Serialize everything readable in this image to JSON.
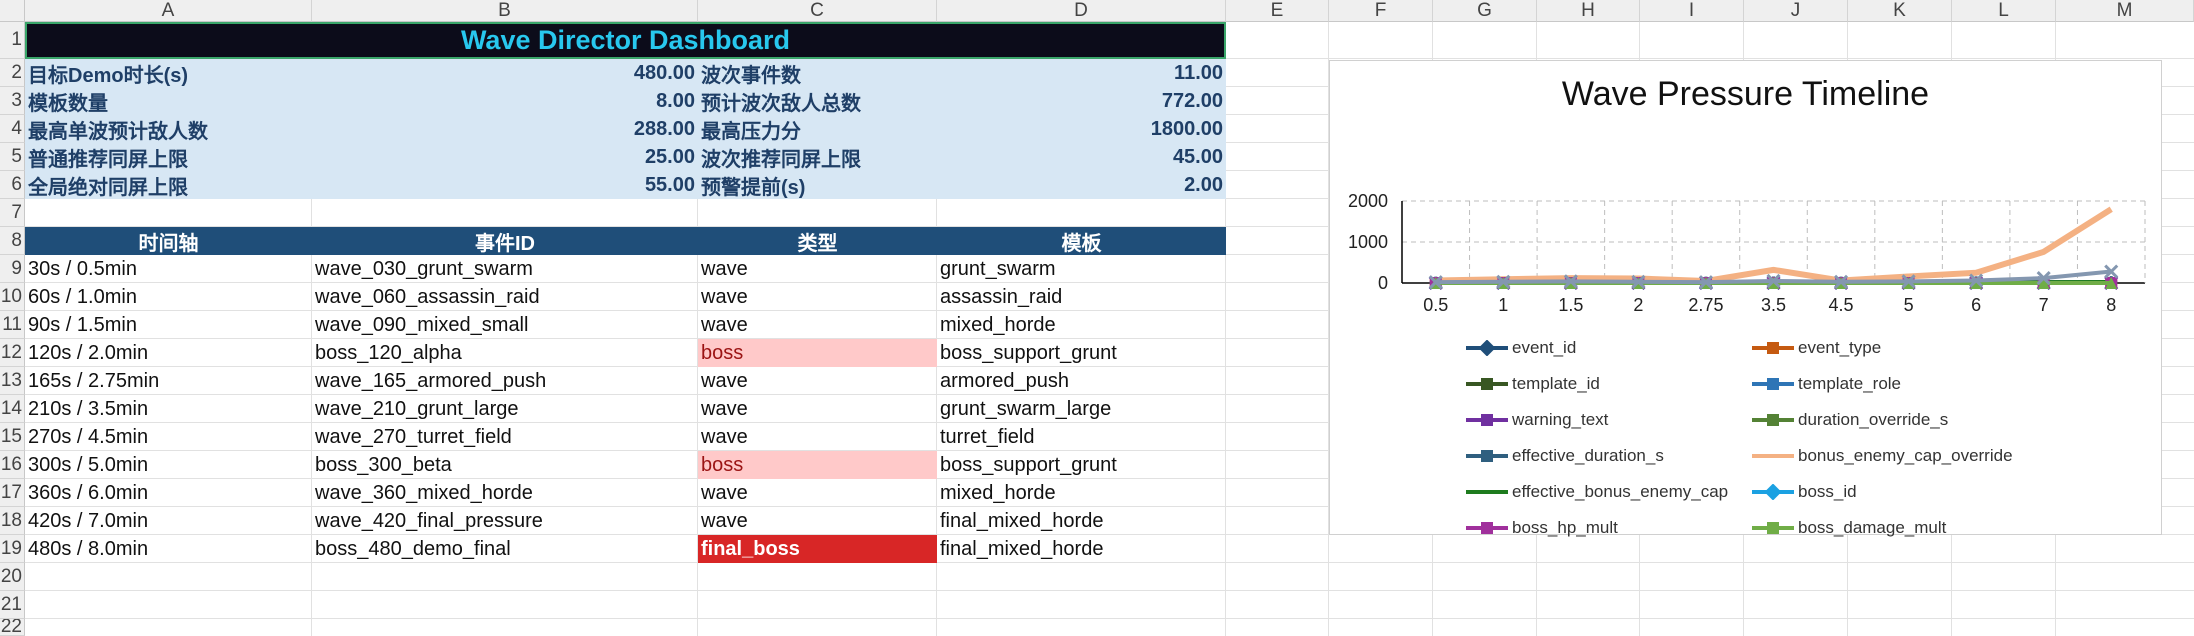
{
  "columns": [
    "A",
    "B",
    "C",
    "D",
    "E",
    "F",
    "G",
    "H",
    "I",
    "J",
    "K",
    "L",
    "M"
  ],
  "rows": [
    "1",
    "2",
    "3",
    "4",
    "5",
    "6",
    "7",
    "8",
    "9",
    "10",
    "11",
    "12",
    "13",
    "14",
    "15",
    "16",
    "17",
    "18",
    "19",
    "20",
    "21",
    "22"
  ],
  "title": "Wave Director Dashboard",
  "summary": [
    {
      "label_left": "目标Demo时长(s)",
      "value_left": "480.00",
      "label_right": "波次事件数",
      "value_right": "11.00"
    },
    {
      "label_left": "模板数量",
      "value_left": "8.00",
      "label_right": "预计波次敌人总数",
      "value_right": "772.00"
    },
    {
      "label_left": "最高单波预计敌人数",
      "value_left": "288.00",
      "label_right": "最高压力分",
      "value_right": "1800.00"
    },
    {
      "label_left": "普通推荐同屏上限",
      "value_left": "25.00",
      "label_right": "波次推荐同屏上限",
      "value_right": "45.00"
    },
    {
      "label_left": "全局绝对同屏上限",
      "value_left": "55.00",
      "label_right": "预警提前(s)",
      "value_right": "2.00"
    }
  ],
  "table": {
    "headers": [
      "时间轴",
      "事件ID",
      "类型",
      "模板"
    ],
    "rows": [
      [
        "30s / 0.5min",
        "wave_030_grunt_swarm",
        "wave",
        "grunt_swarm"
      ],
      [
        "60s / 1.0min",
        "wave_060_assassin_raid",
        "wave",
        "assassin_raid"
      ],
      [
        "90s / 1.5min",
        "wave_090_mixed_small",
        "wave",
        "mixed_horde"
      ],
      [
        "120s / 2.0min",
        "boss_120_alpha",
        "boss",
        "boss_support_grunt"
      ],
      [
        "165s / 2.75min",
        "wave_165_armored_push",
        "wave",
        "armored_push"
      ],
      [
        "210s / 3.5min",
        "wave_210_grunt_large",
        "wave",
        "grunt_swarm_large"
      ],
      [
        "270s / 4.5min",
        "wave_270_turret_field",
        "wave",
        "turret_field"
      ],
      [
        "300s / 5.0min",
        "boss_300_beta",
        "boss",
        "boss_support_grunt"
      ],
      [
        "360s / 6.0min",
        "wave_360_mixed_horde",
        "wave",
        "mixed_horde"
      ],
      [
        "420s / 7.0min",
        "wave_420_final_pressure",
        "wave",
        "final_mixed_horde"
      ],
      [
        "480s / 8.0min",
        "boss_480_demo_final",
        "final_boss",
        "final_mixed_horde"
      ]
    ]
  },
  "chart_data": {
    "type": "line",
    "title": "Wave Pressure Timeline",
    "categories": [
      "0.5",
      "1",
      "1.5",
      "2",
      "2.75",
      "3.5",
      "4.5",
      "5",
      "6",
      "7",
      "8"
    ],
    "ylim": [
      0,
      2000
    ],
    "yticks": [
      "0",
      "1000",
      "2000"
    ],
    "grid": true,
    "legend_position": "bottom",
    "series": [
      {
        "name": "event_id",
        "color": "#1f4e79",
        "marker": "diamond",
        "values": [
          0,
          0,
          0,
          0,
          0,
          0,
          0,
          0,
          0,
          0,
          0
        ]
      },
      {
        "name": "event_type",
        "color": "#c55a11",
        "marker": "square",
        "values": [
          0,
          0,
          0,
          0,
          0,
          0,
          0,
          0,
          0,
          0,
          0
        ]
      },
      {
        "name": "template_id",
        "color": "#385723",
        "marker": "triangle",
        "values": [
          0,
          0,
          0,
          0,
          0,
          0,
          0,
          0,
          0,
          0,
          0
        ]
      },
      {
        "name": "template_role",
        "color": "#2e75b6",
        "marker": "x",
        "values": [
          0,
          0,
          0,
          0,
          0,
          0,
          0,
          0,
          0,
          0,
          0
        ]
      },
      {
        "name": "warning_text",
        "color": "#7030a0",
        "marker": "star",
        "values": [
          0,
          0,
          0,
          0,
          0,
          0,
          0,
          0,
          0,
          0,
          0
        ]
      },
      {
        "name": "duration_override_s",
        "color": "#548235",
        "marker": "circle",
        "values": [
          0,
          0,
          0,
          0,
          0,
          0,
          0,
          0,
          0,
          0,
          0
        ]
      },
      {
        "name": "effective_duration_s",
        "color": "#2f5f7f",
        "marker": "plus",
        "values": [
          10,
          10,
          10,
          12,
          10,
          12,
          10,
          15,
          15,
          20,
          20
        ]
      },
      {
        "name": "bonus_enemy_cap_override",
        "color": "#f4b183",
        "marker": "none",
        "values": [
          60,
          90,
          120,
          110,
          50,
          320,
          60,
          160,
          250,
          760,
          1800
        ]
      },
      {
        "name": "effective_bonus_enemy_cap",
        "color": "#1e7b1e",
        "marker": "none",
        "values": [
          5,
          5,
          8,
          10,
          5,
          10,
          8,
          10,
          15,
          20,
          25
        ]
      },
      {
        "name": "boss_id",
        "color": "#1ba1e2",
        "marker": "diamond",
        "values": [
          0,
          0,
          0,
          0,
          0,
          0,
          0,
          0,
          0,
          0,
          0
        ]
      },
      {
        "name": "boss_hp_mult",
        "color": "#a0309c",
        "marker": "square",
        "values": [
          0,
          0,
          0,
          0,
          0,
          0,
          0,
          0,
          0,
          0,
          0
        ]
      },
      {
        "name": "boss_damage_mult",
        "color": "#70ad47",
        "marker": "triangle",
        "values": [
          0,
          0,
          0,
          0,
          0,
          0,
          0,
          0,
          0,
          0,
          0
        ]
      },
      {
        "name": "",
        "color": "#8497b0",
        "marker": "x",
        "values": [
          20,
          30,
          40,
          30,
          20,
          50,
          30,
          40,
          60,
          120,
          280
        ]
      }
    ]
  }
}
